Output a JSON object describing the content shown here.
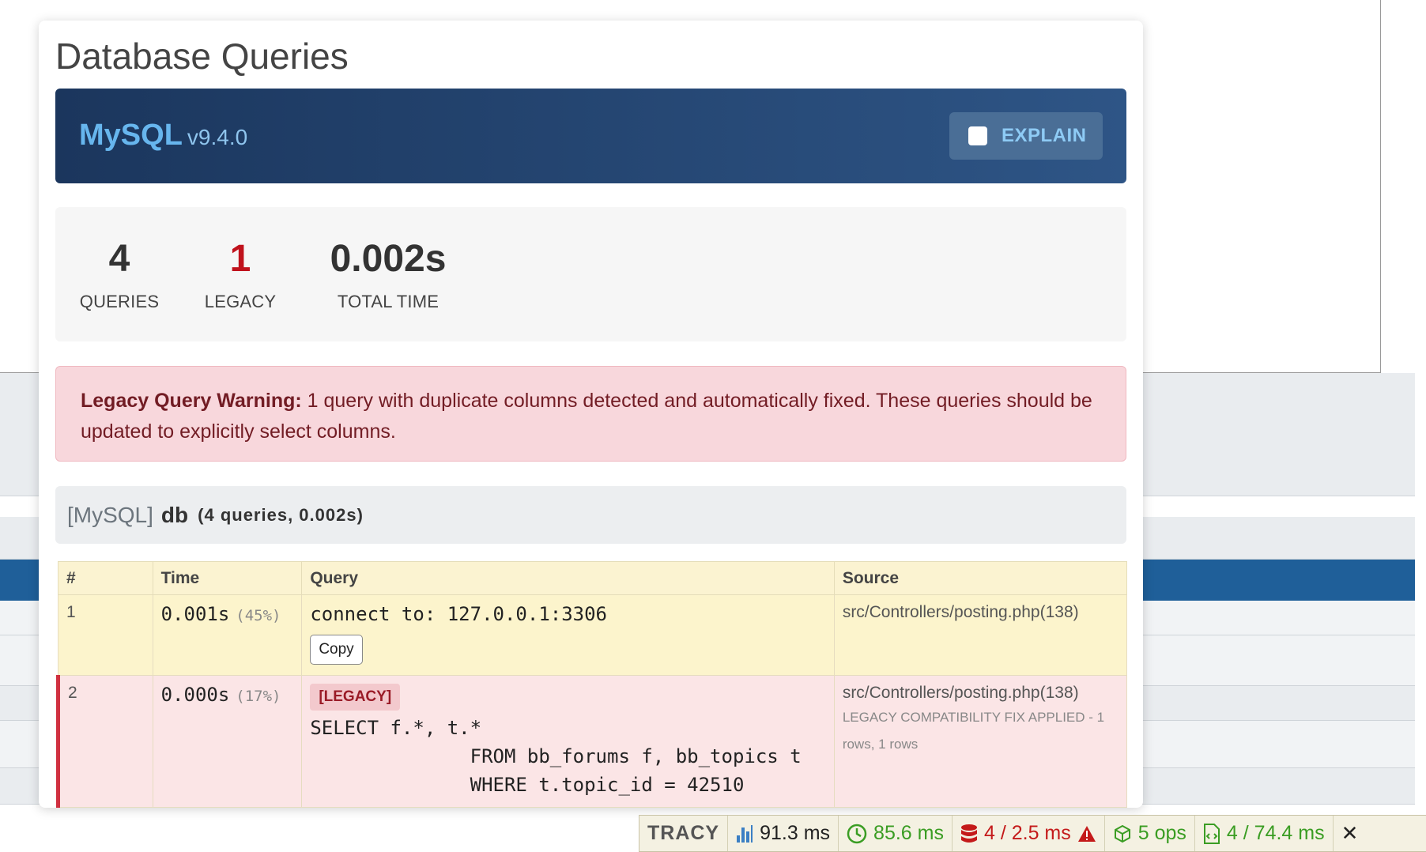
{
  "panel": {
    "title": "Database Queries",
    "engine": "MySQL",
    "version": "v9.4.0",
    "explain_label": "EXPLAIN"
  },
  "stats": [
    {
      "value": "4",
      "label": "QUERIES"
    },
    {
      "value": "1",
      "label": "LEGACY"
    },
    {
      "value": "0.002s",
      "label": "TOTAL TIME"
    }
  ],
  "warning": {
    "title": "Legacy Query Warning:",
    "text": "1 query with duplicate columns detected and automatically fixed. These queries should be updated to explicitly select columns."
  },
  "connection": {
    "engine": "[MySQL]",
    "name": "db",
    "meta": "(4 queries, 0.002s)"
  },
  "table": {
    "headers": [
      "#",
      "Time",
      "Query",
      "Source"
    ],
    "rows": [
      {
        "num": "1",
        "time": "0.001s",
        "pct": "(45%)",
        "query": "connect to: 127.0.0.1:3306",
        "copy_label": "Copy",
        "source": "src/Controllers/posting.php(138)"
      },
      {
        "num": "2",
        "time": "0.000s",
        "pct": "(17%)",
        "tag": "[LEGACY]",
        "query": "SELECT f.*, t.*\n              FROM bb_forums f, bb_topics t\n              WHERE t.topic_id = 42510",
        "source": "src/Controllers/posting.php(138)",
        "note": "LEGACY COMPATIBILITY FIX APPLIED - 1 rows, 1 rows"
      }
    ]
  },
  "tracy_bar": {
    "logo": "TRACY",
    "items": [
      {
        "icon": "bar-chart-icon",
        "text": "91.3 ms",
        "color": "#222222"
      },
      {
        "icon": "clock-icon",
        "text": "85.6 ms",
        "color": "#3a9d23"
      },
      {
        "icon": "database-icon",
        "text": "4 / 2.5 ms",
        "color": "#c41a1a"
      },
      {
        "icon": "cube-icon",
        "text": "5 ops",
        "color": "#3a9d23"
      },
      {
        "icon": "file-code-icon",
        "text": "4 / 74.4 ms",
        "color": "#3a9d23"
      }
    ],
    "close": "✕"
  }
}
